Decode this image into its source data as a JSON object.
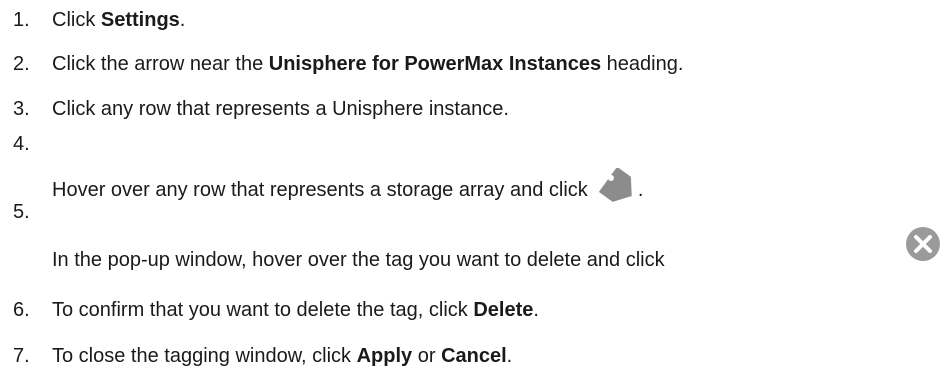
{
  "steps": [
    {
      "number": "1.",
      "before": "Click ",
      "bold1": "Settings",
      "after": "."
    },
    {
      "number": "2.",
      "before": "Click the arrow near the ",
      "bold1": "Unisphere for PowerMax Instances",
      "after": " heading."
    },
    {
      "number": "3.",
      "text": "Click any row that represents a Unisphere instance."
    },
    {
      "number": "4.",
      "text": "Hover over any row that represents a storage array and click",
      "after": ".",
      "icon": "tag-icon"
    },
    {
      "number": "5.",
      "text": "In the pop-up window, hover over the tag you want to delete and click",
      "icon": "close-circle-icon"
    },
    {
      "number": "6.",
      "before": "To confirm that you want to delete the tag, click ",
      "bold1": "Delete",
      "after": "."
    },
    {
      "number": "7.",
      "before": "To close the tagging window, click ",
      "bold1": "Apply",
      "middle": " or ",
      "bold2": "Cancel",
      "after": "."
    }
  ],
  "colors": {
    "text": "#1a1a1a",
    "icon_gray": "#8c8c8c"
  }
}
